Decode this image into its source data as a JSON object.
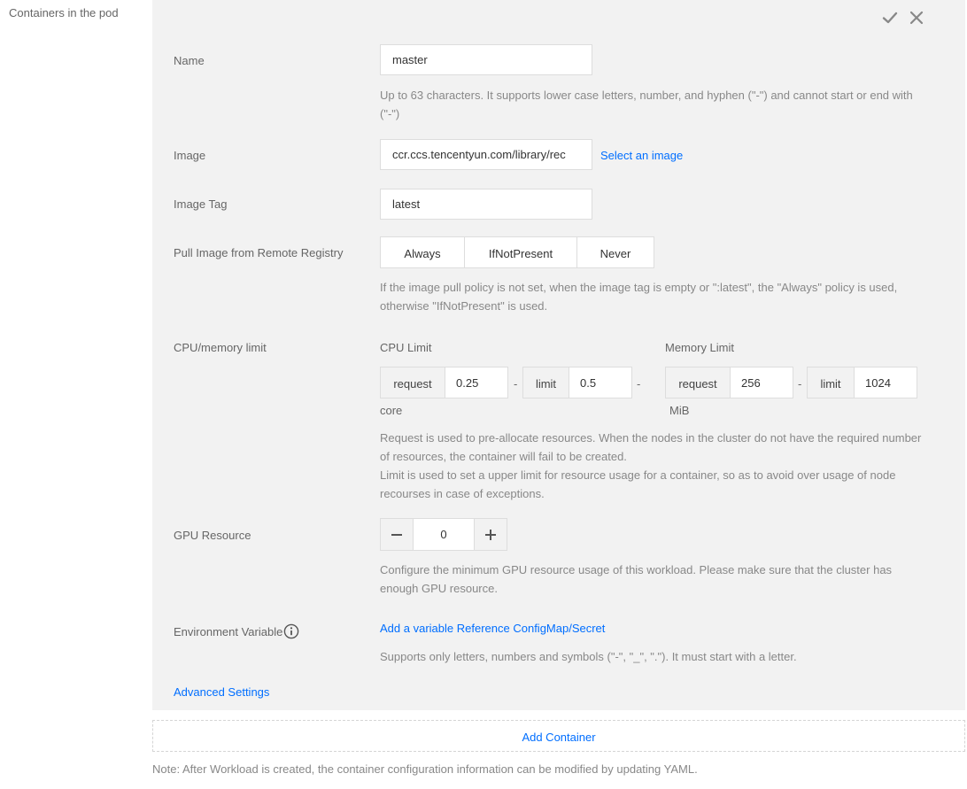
{
  "section": {
    "label": "Containers in the pod"
  },
  "header": {
    "confirm_icon": "check-icon",
    "close_icon": "close-icon"
  },
  "name": {
    "label": "Name",
    "value": "master",
    "help": "Up to 63 characters. It supports lower case letters, number, and hyphen (\"-\") and cannot start or end with (\"-\")"
  },
  "image": {
    "label": "Image",
    "value": "ccr.ccs.tencentyun.com/library/rec",
    "select_link": "Select an image"
  },
  "image_tag": {
    "label": "Image Tag",
    "value": "latest"
  },
  "pull_policy": {
    "label": "Pull Image from Remote Registry",
    "options": [
      "Always",
      "IfNotPresent",
      "Never"
    ],
    "help": "If the image pull policy is not set, when the image tag is empty or \":latest\", the \"Always\" policy is used, otherwise \"IfNotPresent\" is used."
  },
  "resources": {
    "label": "CPU/memory limit",
    "cpu": {
      "title": "CPU Limit",
      "request_label": "request",
      "request": "0.25",
      "limit_label": "limit",
      "limit": "0.5",
      "unit": "core",
      "separator": "-"
    },
    "memory": {
      "title": "Memory Limit",
      "request_label": "request",
      "request": "256",
      "limit_label": "limit",
      "limit": "1024",
      "unit": "MiB",
      "separator": "-"
    },
    "help_1": "Request is used to pre-allocate resources. When the nodes in the cluster do not have the required number of resources, the container will fail to be created.",
    "help_2": "Limit is used to set a upper limit for resource usage for a container, so as to avoid over usage of node recourses in case of exceptions."
  },
  "gpu": {
    "label": "GPU Resource",
    "value": "0",
    "help": "Configure the minimum GPU resource usage of this workload. Please make sure that the cluster has enough GPU resource."
  },
  "env": {
    "label": "Environment Variable",
    "add_link": "Add a variable",
    "ref_link": "Reference ConfigMap/Secret",
    "help": "Supports only letters, numbers and symbols (\"-\", \"_\", \".\"). It must start with a letter."
  },
  "advanced": {
    "link": "Advanced Settings"
  },
  "add_container": {
    "label": "Add Container"
  },
  "note": "Note: After Workload is created, the container configuration information can be modified by updating YAML.",
  "colors": {
    "panel_bg": "#f2f2f2",
    "link": "#006eff",
    "border": "#dddddd"
  }
}
